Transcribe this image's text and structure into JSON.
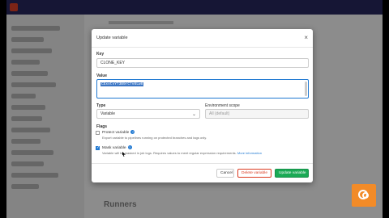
{
  "modal": {
    "title": "Update variable",
    "close_glyph": "×",
    "key_label": "Key",
    "key_value": "CLONE_KEY",
    "value_label": "Value",
    "value_text": "CExvtvYT3B9rCfv6Lw8",
    "type_label": "Type",
    "type_value": "Variable",
    "scope_label": "Environment scope",
    "scope_value": "All (default)",
    "flags_label": "Flags",
    "protect_title": "Protect variable",
    "protect_help": "Export variable to pipelines running on protected branches and tags only.",
    "mask_title": "Mask variable",
    "mask_help": "Variable will be masked in job logs. Requires values to meet regular expression requirements.",
    "mask_link": "More information",
    "cancel_label": "Cancel",
    "delete_label": "Delete variable",
    "update_label": "Update variable"
  },
  "page": {
    "runners_heading": "Runners"
  },
  "colors": {
    "topbar": "#292961",
    "primary": "#1f78d1",
    "danger": "#db3b21",
    "success": "#1aaa55",
    "watermark": "#f28b28"
  },
  "icons": [
    "close-icon",
    "info-icon",
    "chevron-down-icon",
    "checkbox-icon",
    "cursor-icon",
    "watermark-logo-icon"
  ]
}
